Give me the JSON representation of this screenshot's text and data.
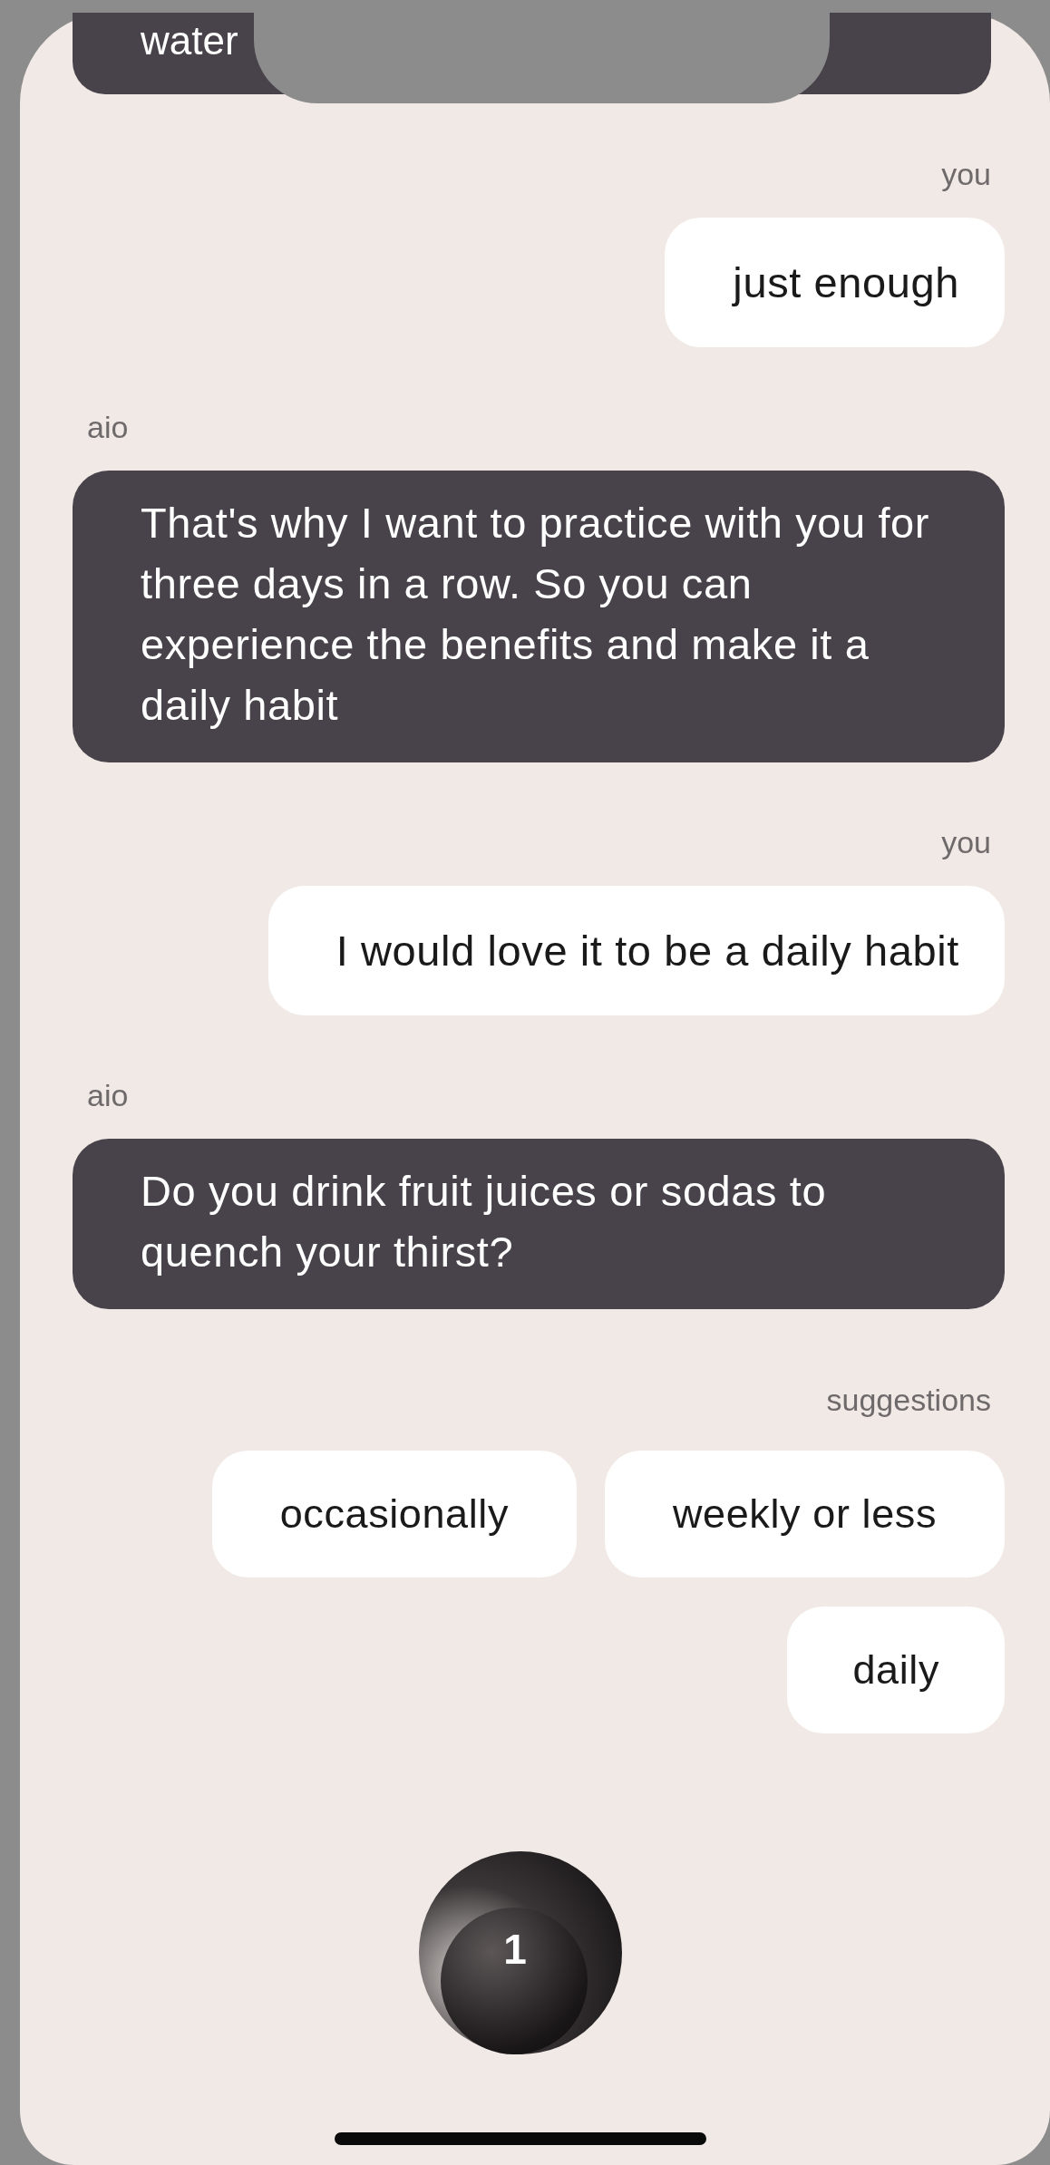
{
  "top_message": {
    "text": "water"
  },
  "messages": [
    {
      "kind": "user",
      "sender": "you",
      "text": "just enough"
    },
    {
      "kind": "bot",
      "sender": "aio",
      "text": "That's why I want to practice with you for three days in a row. So you can experience the benefits and make it a daily habit"
    },
    {
      "kind": "user",
      "sender": "you",
      "text": "I would love it to be a daily habit"
    },
    {
      "kind": "bot",
      "sender": "aio",
      "text": "Do you drink fruit juices or sodas to quench your thirst?"
    }
  ],
  "suggestions": {
    "label": "suggestions",
    "options": [
      "occasionally",
      "weekly or less",
      "daily"
    ]
  },
  "counter_button": {
    "count": "1"
  }
}
